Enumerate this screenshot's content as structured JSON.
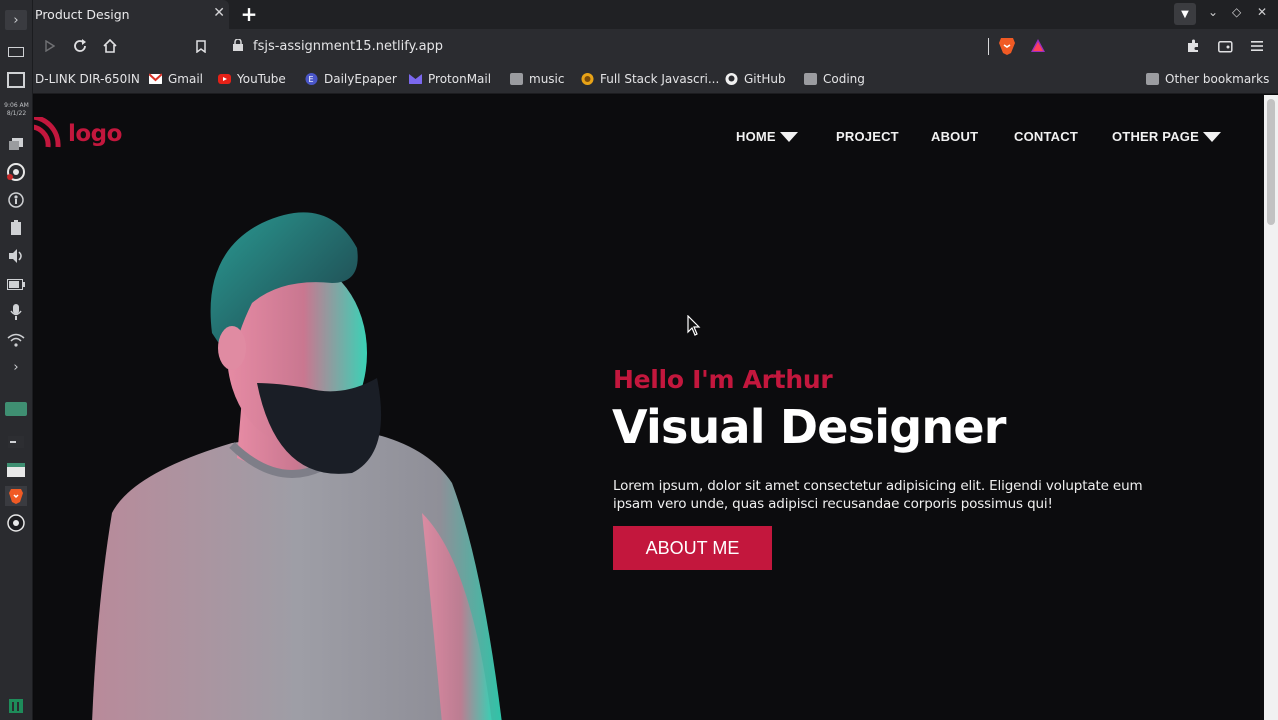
{
  "browser": {
    "tab_title": "Product Design",
    "tab_close": "✕",
    "new_tab": "+",
    "url": "fsjs-assignment15.netlify.app",
    "window_controls": [
      "⌄",
      "◇",
      "✕"
    ]
  },
  "taskbar": {
    "clock_time": "9:06 AM",
    "clock_date": "8/1/22"
  },
  "bookmarks": [
    {
      "label": "D-LINK DIR-650IN",
      "icon": "none"
    },
    {
      "label": "Gmail",
      "icon": "gmail-icon"
    },
    {
      "label": "YouTube",
      "icon": "youtube-icon"
    },
    {
      "label": "DailyEpaper",
      "icon": "dailyepaper-icon"
    },
    {
      "label": "ProtonMail",
      "icon": "protonmail-icon"
    },
    {
      "label": "music",
      "icon": "folder-icon"
    },
    {
      "label": "Full Stack Javascri...",
      "icon": "fullstack-icon"
    },
    {
      "label": "GitHub",
      "icon": "github-icon"
    },
    {
      "label": "Coding",
      "icon": "folder-icon"
    },
    {
      "label": "Other bookmarks",
      "icon": "folder-icon"
    }
  ],
  "site": {
    "logo_text": "logo",
    "nav": [
      {
        "label": "HOME",
        "dropdown": true
      },
      {
        "label": "PROJECT",
        "dropdown": false
      },
      {
        "label": "ABOUT",
        "dropdown": false
      },
      {
        "label": "CONTACT",
        "dropdown": false
      },
      {
        "label": "OTHER PAGE",
        "dropdown": true
      }
    ],
    "hero": {
      "greeting": "Hello I'm Arthur",
      "title": "Visual Designer",
      "description": "Lorem ipsum, dolor sit amet consectetur adipisicing elit. Eligendi voluptate eum ipsam vero unde, quas adipisci recusandae corporis possimus qui!",
      "button_label": "ABOUT ME"
    },
    "colors": {
      "accent": "#c3173d",
      "background": "#0c0c0e",
      "text": "#ffffff"
    }
  }
}
